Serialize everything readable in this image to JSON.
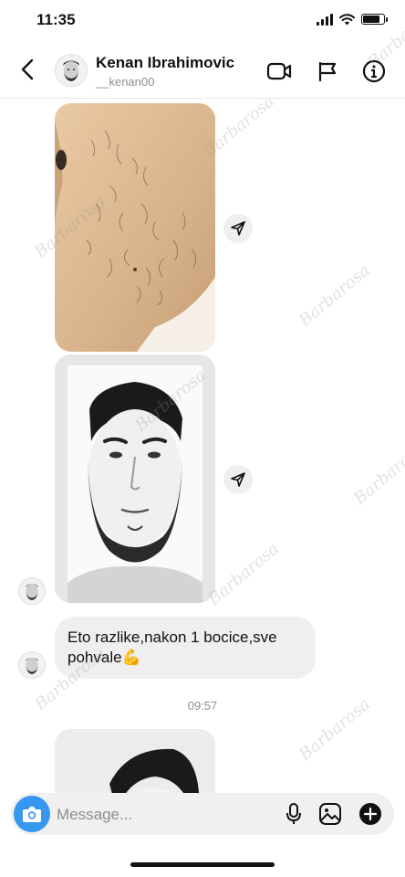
{
  "status_bar": {
    "time": "11:35",
    "battery_level": 0.85
  },
  "header": {
    "name": "Kenan Ibrahimovic",
    "username": "__kenan00",
    "icons": [
      "back-icon",
      "video-call-icon",
      "flag-icon",
      "info-icon"
    ]
  },
  "chat": {
    "messages": [
      {
        "type": "image",
        "description": "beard close-up photo"
      },
      {
        "type": "image",
        "description": "black and white portrait photo"
      },
      {
        "type": "text",
        "text": "Eto razlike,nakon 1 bocice,sve pohvale💪"
      }
    ],
    "timestamp": "09:57"
  },
  "composer": {
    "placeholder": "Message...",
    "icons": [
      "camera-icon",
      "microphone-icon",
      "gallery-icon",
      "plus-icon"
    ]
  },
  "watermark": "Barbarosa",
  "colors": {
    "accent": "#3797f0",
    "bubble": "#efefef",
    "text": "#111111",
    "muted": "#8e8e8e"
  }
}
